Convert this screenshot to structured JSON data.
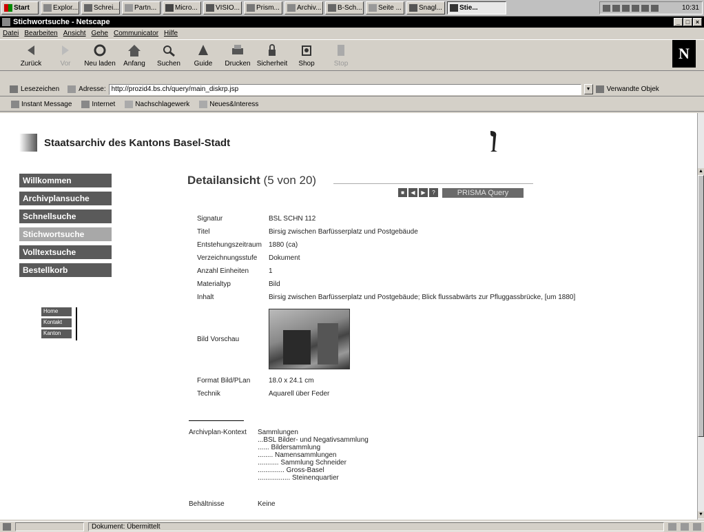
{
  "taskbar": {
    "start_label": "Start",
    "tasks": [
      "Explor...",
      "Schrei...",
      "Partn...",
      "Micro...",
      "VISIO...",
      "Prism...",
      "Archiv...",
      "B-Sch...",
      "Seite ...",
      "Snagl...",
      "Stie..."
    ],
    "clock": "10:31"
  },
  "window": {
    "title": "Stichwortsuche - Netscape"
  },
  "menu": [
    "Datei",
    "Bearbeiten",
    "Ansicht",
    "Gehe",
    "Communicator",
    "Hilfe"
  ],
  "toolbar": {
    "buttons": [
      "Zurück",
      "Vor",
      "Neu laden",
      "Anfang",
      "Suchen",
      "Guide",
      "Drucken",
      "Sicherheit",
      "Shop",
      "Stop"
    ],
    "brand": "N"
  },
  "location": {
    "bookmarks_label": "Lesezeichen",
    "address_label": "Adresse:",
    "url": "http://prozid4.bs.ch/query/main_diskrp.jsp",
    "related_label": "Verwandte Objek"
  },
  "personal": [
    "Instant Message",
    "Internet",
    "Nachschlagewerk",
    "Neues&Interess"
  ],
  "page": {
    "site_title": "Staatsarchiv des Kantons Basel-Stadt",
    "nav": [
      "Willkommen",
      "Archivplansuche",
      "Schnellsuche",
      "Stichwortsuche",
      "Volltextsuche",
      "Bestellkorb"
    ],
    "mini_nav": [
      "Home",
      "Kontakt",
      "Kanton"
    ],
    "detail_title": "Detailansicht",
    "detail_count": "(5 von 20)",
    "pager": {
      "prisma_label": "PRISMA Query"
    },
    "fields": [
      {
        "label": "Signatur",
        "value": "BSL SCHN 112"
      },
      {
        "label": "Titel",
        "value": "Birsig zwischen Barfüsserplatz und Postgebäude"
      },
      {
        "label": "Entstehungszeitraum",
        "value": "1880 (ca)"
      },
      {
        "label": "Verzeichnungsstufe",
        "value": "Dokument"
      },
      {
        "label": "Anzahl Einheiten",
        "value": "1"
      },
      {
        "label": "Materialtyp",
        "value": "Bild"
      },
      {
        "label": "Inhalt",
        "value": "Birsig zwischen Barfüsserplatz und Postgebäude; Blick flussabwärts zur Pfluggassbrücke, [um 1880]"
      }
    ],
    "preview_label": "Bild Vorschau",
    "fields2": [
      {
        "label": "Format Bild/PLan",
        "value": "18.0 x 24.1 cm"
      },
      {
        "label": "Technik",
        "value": "Aquarell über Feder"
      }
    ],
    "context_label": "Archivplan-Kontext",
    "context_lines": [
      "Sammlungen",
      "...BSL Bilder- und Negativsammlung",
      "...... Bildersammlung",
      "........ Namensammlungen",
      "........... Sammlung Schneider",
      ".............. Gross-Basel",
      "................. Steinenquartier"
    ],
    "containers_label": "Behältnisse",
    "containers_value": "Keine"
  },
  "status": {
    "text": "Dokument: Übermittelt"
  }
}
